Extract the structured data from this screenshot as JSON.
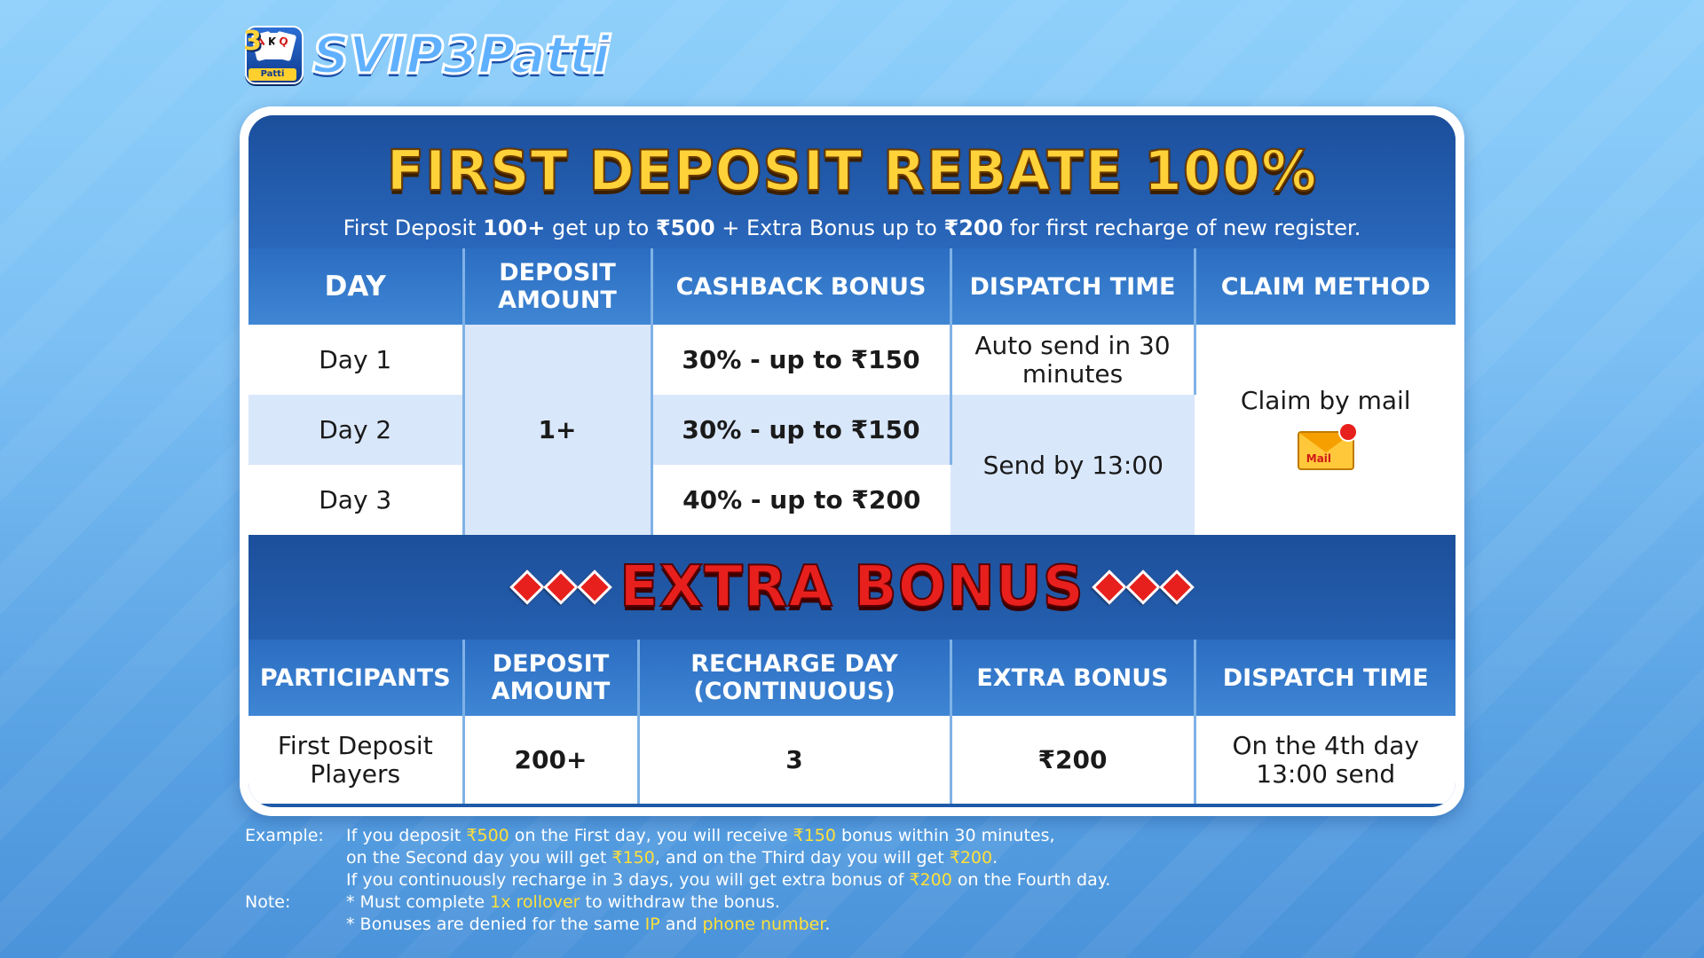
{
  "brand": {
    "logo_text": "SVIP3Patti",
    "badge_number": "3",
    "badge_label": "Patti"
  },
  "hero": {
    "title": "FIRST DEPOSIT REBATE 100%",
    "subtitle_parts": [
      "First Deposit ",
      "100+",
      " get up to ",
      "₹500",
      " + Extra Bonus up to ",
      "₹200",
      " for first recharge of new register."
    ]
  },
  "rebate_table": {
    "headers": [
      "DAY",
      "DEPOSIT AMOUNT",
      "CASHBACK BONUS",
      "DISPATCH TIME",
      "CLAIM METHOD"
    ],
    "rows": [
      {
        "day": "Day 1",
        "cashback": "30% - up to ₹150"
      },
      {
        "day": "Day 2",
        "cashback": "30% - up to ₹150"
      },
      {
        "day": "Day 3",
        "cashback": "40% - up to ₹200"
      }
    ],
    "deposit_amount": "1+",
    "dispatch_day1": "Auto send in 30 minutes",
    "dispatch_day23": "Send by 13:00",
    "claim_method": "Claim by mail",
    "mail_icon_label": "Mail"
  },
  "extra": {
    "title": "EXTRA BONUS",
    "headers": [
      "PARTICIPANTS",
      "DEPOSIT AMOUNT",
      "RECHARGE DAY (CONTINUOUS)",
      "EXTRA BONUS",
      "DISPATCH TIME"
    ],
    "row": {
      "participants": "First Deposit Players",
      "deposit": "200+",
      "recharge_day": "3",
      "bonus": "₹200",
      "dispatch": "On the 4th day 13:00 send"
    }
  },
  "notes": {
    "example_label": "Example:",
    "note_label": "Note:",
    "lines": [
      [
        "If you deposit ",
        "₹500",
        " on the First day, you will receive ",
        "₹150",
        " bonus within 30 minutes,"
      ],
      [
        "on the Second day you will get ",
        "₹150",
        ", and on the Third day you will get ",
        "₹200",
        "."
      ],
      [
        "If you continuously recharge in 3 days, you will get extra bonus of ",
        "₹200",
        " on the Fourth day."
      ]
    ],
    "note_lines": [
      [
        "* Must complete ",
        "1x rollover",
        " to withdraw the bonus."
      ],
      [
        "* Bonuses are denied for the same ",
        "IP",
        " and ",
        "phone number",
        "."
      ]
    ]
  },
  "colors": {
    "title_gold": "#ffd23a",
    "extra_red": "#e8201d",
    "highlight_yellow": "#ffe03a",
    "header_blue": "#2b6dc2"
  }
}
